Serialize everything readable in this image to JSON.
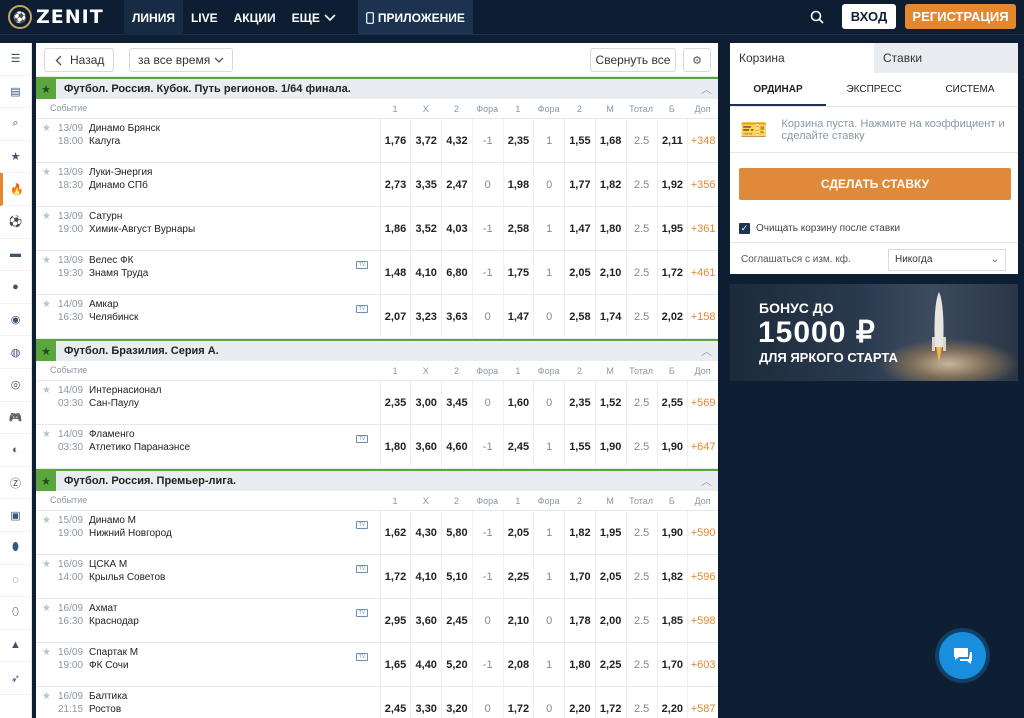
{
  "brand": {
    "name": "ZENIT"
  },
  "nav": {
    "items": [
      "ЛИНИЯ",
      "LIVE",
      "АКЦИИ",
      "ЕЩЕ"
    ],
    "app": "ПРИЛОЖЕНИЕ"
  },
  "auth": {
    "login": "ВХОД",
    "register": "РЕГИСТРАЦИЯ"
  },
  "toolbar": {
    "back": "Назад",
    "period": "за все время",
    "collapse": "Свернуть все"
  },
  "columns": [
    "Событие",
    "1",
    "X",
    "2",
    "Фора",
    "1",
    "Фора",
    "2",
    "М",
    "Тотал",
    "Б",
    "Доп"
  ],
  "leagues": [
    {
      "title": "Футбол. Россия. Кубок. Путь регионов. 1/64 финала.",
      "events": [
        {
          "date": "13/09",
          "time": "18:00",
          "team1": "Динамо Брянск",
          "team2": "Калуга",
          "tv": false,
          "odds": [
            "1,76",
            "3,72",
            "4,32",
            "-1",
            "2,35",
            "1",
            "1,55",
            "1,68",
            "2.5",
            "2,11",
            "+348"
          ]
        },
        {
          "date": "13/09",
          "time": "18:30",
          "team1": "Луки-Энергия",
          "team2": "Динамо СПб",
          "tv": false,
          "odds": [
            "2,73",
            "3,35",
            "2,47",
            "0",
            "1,98",
            "0",
            "1,77",
            "1,82",
            "2.5",
            "1,92",
            "+356"
          ]
        },
        {
          "date": "13/09",
          "time": "19:00",
          "team1": "Сатурн",
          "team2": "Химик-Август Вурнары",
          "tv": false,
          "odds": [
            "1,86",
            "3,52",
            "4,03",
            "-1",
            "2,58",
            "1",
            "1,47",
            "1,80",
            "2.5",
            "1,95",
            "+361"
          ]
        },
        {
          "date": "13/09",
          "time": "19:30",
          "team1": "Велес ФК",
          "team2": "Знамя Труда",
          "tv": true,
          "odds": [
            "1,48",
            "4,10",
            "6,80",
            "-1",
            "1,75",
            "1",
            "2,05",
            "2,10",
            "2.5",
            "1,72",
            "+461"
          ]
        },
        {
          "date": "14/09",
          "time": "16:30",
          "team1": "Амкар",
          "team2": "Челябинск",
          "tv": true,
          "odds": [
            "2,07",
            "3,23",
            "3,63",
            "0",
            "1,47",
            "0",
            "2,58",
            "1,74",
            "2.5",
            "2,02",
            "+158"
          ]
        }
      ]
    },
    {
      "title": "Футбол. Бразилия. Серия А.",
      "events": [
        {
          "date": "14/09",
          "time": "03:30",
          "team1": "Интернасионал",
          "team2": "Сан-Паулу",
          "tv": false,
          "odds": [
            "2,35",
            "3,00",
            "3,45",
            "0",
            "1,60",
            "0",
            "2,35",
            "1,52",
            "2.5",
            "2,55",
            "+569"
          ]
        },
        {
          "date": "14/09",
          "time": "03:30",
          "team1": "Фламенго",
          "team2": "Атлетико Паранаэнсе",
          "tv": true,
          "odds": [
            "1,80",
            "3,60",
            "4,60",
            "-1",
            "2,45",
            "1",
            "1,55",
            "1,90",
            "2.5",
            "1,90",
            "+647"
          ]
        }
      ]
    },
    {
      "title": "Футбол. Россия. Премьер-лига.",
      "events": [
        {
          "date": "15/09",
          "time": "19:00",
          "team1": "Динамо М",
          "team2": "Нижний Новгород",
          "tv": true,
          "odds": [
            "1,62",
            "4,30",
            "5,80",
            "-1",
            "2,05",
            "1",
            "1,82",
            "1,95",
            "2.5",
            "1,90",
            "+590"
          ]
        },
        {
          "date": "16/09",
          "time": "14:00",
          "team1": "ЦСКА М",
          "team2": "Крылья Советов",
          "tv": true,
          "odds": [
            "1,72",
            "4,10",
            "5,10",
            "-1",
            "2,25",
            "1",
            "1,70",
            "2,05",
            "2.5",
            "1,82",
            "+596"
          ]
        },
        {
          "date": "16/09",
          "time": "16:30",
          "team1": "Ахмат",
          "team2": "Краснодар",
          "tv": true,
          "odds": [
            "2,95",
            "3,60",
            "2,45",
            "0",
            "2,10",
            "0",
            "1,78",
            "2,00",
            "2.5",
            "1,85",
            "+598"
          ]
        },
        {
          "date": "16/09",
          "time": "19:00",
          "team1": "Спартак М",
          "team2": "ФК Сочи",
          "tv": true,
          "odds": [
            "1,65",
            "4,40",
            "5,20",
            "-1",
            "2,08",
            "1",
            "1,80",
            "2,25",
            "2.5",
            "1,70",
            "+603"
          ]
        },
        {
          "date": "16/09",
          "time": "21:15",
          "team1": "Балтика",
          "team2": "Ростов",
          "tv": false,
          "odds": [
            "2,45",
            "3,30",
            "3,20",
            "0",
            "1,72",
            "0",
            "2,20",
            "1,72",
            "2.5",
            "2,20",
            "+587"
          ]
        }
      ]
    }
  ],
  "betslip": {
    "tab_cart": "Корзина",
    "tab_bets": "Ставки",
    "modes": [
      "ОРДИНАР",
      "ЭКСПРЕСС",
      "СИСТЕМА"
    ],
    "empty_text": "Корзина пуста. Нажмите на коэффициент и сделайте ставку",
    "make_bet": "СДЕЛАТЬ СТАВКУ",
    "clear_label": "Очищать корзину после ставки",
    "agree_label": "Соглашаться с изм. кф.",
    "agree_value": "Никогда"
  },
  "banner": {
    "line1": "БОНУС ДО",
    "line2": "15000 ₽",
    "line3": "ДЛЯ ЯРКОГО СТАРТА"
  },
  "colors": {
    "accent": "#e3882f",
    "header": "#0d1e33",
    "league_green": "#5aa53e",
    "chat": "#1a8ede"
  }
}
